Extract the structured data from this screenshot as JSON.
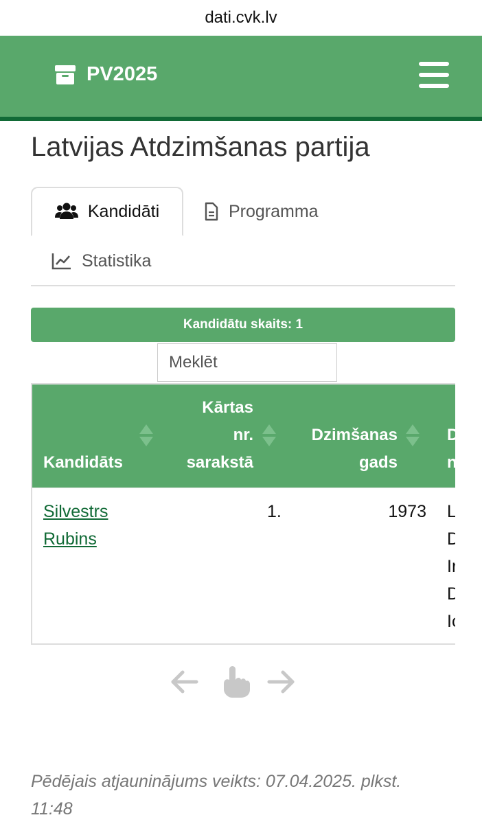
{
  "browser": {
    "url": "dati.cvk.lv"
  },
  "navbar": {
    "brand": "PV2025",
    "brand_icon": "archive-icon",
    "menu_icon": "hamburger-icon",
    "background": "#59a86b",
    "border": "#116a36"
  },
  "page": {
    "title": "Latvijas Atdzimšanas partija"
  },
  "tabs": [
    {
      "label": "Kandidāti",
      "icon": "users-icon",
      "active": true
    },
    {
      "label": "Programma",
      "icon": "document-icon",
      "active": false
    },
    {
      "label": "Statistika",
      "icon": "chart-line-icon",
      "active": false
    }
  ],
  "summary": {
    "candidate_count": "Kandidātu skaits: 1"
  },
  "search": {
    "placeholder": "Meklēt"
  },
  "table": {
    "headers": {
      "candidate": "Kandidāts",
      "list_no_1": "Kārtas",
      "list_no_2": "nr.",
      "list_no_3": "sarakstā",
      "birth_1": "Dzimšanas",
      "birth_2": "gads",
      "next_1": "D",
      "next_2": "n"
    },
    "rows": [
      {
        "candidate_first": "Silvestrs",
        "candidate_last": "Rubins",
        "list_no": "1.",
        "birth_year": "1973",
        "clipped_lines": [
          "L",
          "D",
          "Ir",
          "D",
          "Ic"
        ]
      }
    ]
  },
  "footer": {
    "line1": "Pēdējais atjauninājums veikts: 07.04.2025. plkst.",
    "line2": "11:48"
  }
}
